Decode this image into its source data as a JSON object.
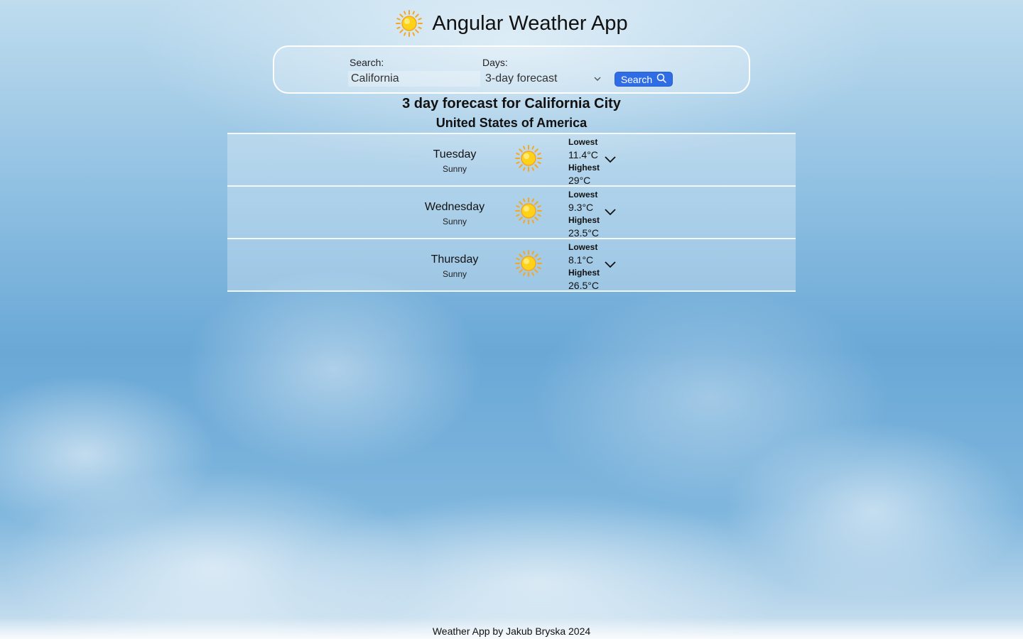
{
  "header": {
    "title": "Angular Weather App",
    "icon": "sun-icon"
  },
  "search": {
    "search_label": "Search:",
    "search_value": "California",
    "days_label": "Days:",
    "days_selected": "3-day forecast",
    "button_label": "Search"
  },
  "forecast": {
    "title": "3 day forecast for California City",
    "country": "United States of America",
    "lowest_label": "Lowest",
    "highest_label": "Highest",
    "days": [
      {
        "day": "Tuesday",
        "condition": "Sunny",
        "low": "11.4°C",
        "high": "29°C"
      },
      {
        "day": "Wednesday",
        "condition": "Sunny",
        "low": "9.3°C",
        "high": "23.5°C"
      },
      {
        "day": "Thursday",
        "condition": "Sunny",
        "low": "8.1°C",
        "high": "26.5°C"
      }
    ]
  },
  "footer": {
    "text": "Weather App by Jakub Bryska 2024"
  },
  "colors": {
    "accent": "#2f6de6",
    "sun": "#ffd21a"
  }
}
